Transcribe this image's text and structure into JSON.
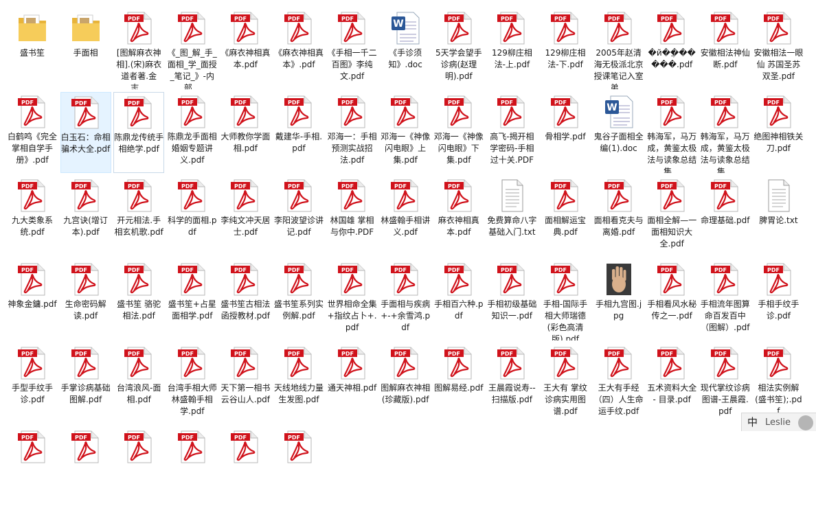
{
  "items": [
    {
      "label": "盛书笙",
      "icon": "folder-icon"
    },
    {
      "label": "手面相",
      "icon": "folder-icon"
    },
    {
      "label": "[图解麻衣神相].(宋)麻衣道者著.金志…",
      "icon": "pdf-icon"
    },
    {
      "label": "《_图_解_手_面相_学_面授_笔记_》-内部…",
      "icon": "pdf-icon"
    },
    {
      "label": "《麻衣神相真本.pdf",
      "icon": "pdf-icon"
    },
    {
      "label": "《麻衣神相真本》.pdf",
      "icon": "pdf-icon"
    },
    {
      "label": "《手相一千二百图》李纯文.pdf",
      "icon": "pdf-icon"
    },
    {
      "label": "《手诊须知》.doc",
      "icon": "word-icon"
    },
    {
      "label": "5天学会望手诊病(赵理明).pdf",
      "icon": "pdf-icon"
    },
    {
      "label": "129柳庄相法-上.pdf",
      "icon": "pdf-icon"
    },
    {
      "label": "129柳庄相法-下.pdf",
      "icon": "pdf-icon"
    },
    {
      "label": "2005年赵清海无极派北京授课笔记入室弟…",
      "icon": "pdf-icon"
    },
    {
      "label": "�й�ֲ������.pdf",
      "icon": "pdf-icon"
    },
    {
      "label": "安徽相法神仙断.pdf",
      "icon": "pdf-icon"
    },
    {
      "label": "安徽相法一眼仙 苏国圣苏双圣.pdf",
      "icon": "pdf-icon"
    },
    {
      "label": "白鹤鸣《完全掌相自学手册》.pdf",
      "icon": "pdf-icon"
    },
    {
      "label": "白玉石：命相骗术大全.pdf",
      "icon": "pdf-icon"
    },
    {
      "label": "陈鼎龙传统手相绝学.pdf",
      "icon": "pdf-icon"
    },
    {
      "label": "陈鼎龙手面相婚姻专题讲义.pdf",
      "icon": "pdf-icon"
    },
    {
      "label": "大师教你学面相.pdf",
      "icon": "pdf-icon"
    },
    {
      "label": "戴建华-手相.pdf",
      "icon": "pdf-icon"
    },
    {
      "label": "邓海一：手相预测实战招法.pdf",
      "icon": "pdf-icon"
    },
    {
      "label": "邓海一《神像闪电眼》上集.pdf",
      "icon": "pdf-icon"
    },
    {
      "label": "邓海一《神像闪电眼》下集.pdf",
      "icon": "pdf-icon"
    },
    {
      "label": "高飞-揭开相学密码-手相过十关.PDF",
      "icon": "pdf-icon"
    },
    {
      "label": "骨相学.pdf",
      "icon": "pdf-icon"
    },
    {
      "label": "鬼谷子面相全编(1).doc",
      "icon": "word-icon"
    },
    {
      "label": "韩海军，马万成，黄鉴太极法与读象总结集…",
      "icon": "pdf-icon"
    },
    {
      "label": "韩海军，马万成，黄鉴太极法与读象总结集…",
      "icon": "pdf-icon"
    },
    {
      "label": "绝图神相铁关刀.pdf",
      "icon": "pdf-icon"
    },
    {
      "label": "九大类象系统.pdf",
      "icon": "pdf-icon"
    },
    {
      "label": "九宫诀(增订本).pdf",
      "icon": "pdf-icon"
    },
    {
      "label": "开元相法.手相玄机歌.pdf",
      "icon": "pdf-icon"
    },
    {
      "label": "科学的面相.pdf",
      "icon": "pdf-icon"
    },
    {
      "label": "李纯文冲天居士.pdf",
      "icon": "pdf-icon"
    },
    {
      "label": "李阳波望诊讲记.pdf",
      "icon": "pdf-icon"
    },
    {
      "label": "林国雄 掌相与你中.PDF",
      "icon": "pdf-icon"
    },
    {
      "label": "林盛翰手相讲义.pdf",
      "icon": "pdf-icon"
    },
    {
      "label": "麻衣神相真本.pdf",
      "icon": "pdf-icon"
    },
    {
      "label": "免费算命八字基础入门.txt",
      "icon": "txt-icon"
    },
    {
      "label": "面相解运宝典.pdf",
      "icon": "pdf-icon"
    },
    {
      "label": "面相看克夫与离婚.pdf",
      "icon": "pdf-icon"
    },
    {
      "label": "面相全解—一面相知识大全.pdf",
      "icon": "pdf-icon"
    },
    {
      "label": "命理基础.pdf",
      "icon": "pdf-icon"
    },
    {
      "label": "脾胃论.txt",
      "icon": "txt-icon"
    },
    {
      "label": "神象金鏞.pdf",
      "icon": "pdf-icon"
    },
    {
      "label": "生命密码解读.pdf",
      "icon": "pdf-icon"
    },
    {
      "label": "盛书笙 骆驼相法.pdf",
      "icon": "pdf-icon"
    },
    {
      "label": "盛书笙+占星面相学.pdf",
      "icon": "pdf-icon"
    },
    {
      "label": "盛书笙古相法函授教材.pdf",
      "icon": "pdf-icon"
    },
    {
      "label": "盛书笙系列实例解.pdf",
      "icon": "pdf-icon"
    },
    {
      "label": "世界相命全集+指纹占卜+.pdf",
      "icon": "pdf-icon"
    },
    {
      "label": "手面相与疾病+-+余雪鸿.pdf",
      "icon": "pdf-icon"
    },
    {
      "label": "手相百六种.pdf",
      "icon": "pdf-icon"
    },
    {
      "label": "手相初级基础知识一.pdf",
      "icon": "pdf-icon"
    },
    {
      "label": "手相-国际手相大师瑞德(彩色高清版).pdf",
      "icon": "pdf-icon"
    },
    {
      "label": "手相九宫图.jpg",
      "icon": "hand-image-icon"
    },
    {
      "label": "手相看风水秘传之一.pdf",
      "icon": "pdf-icon"
    },
    {
      "label": "手相流年图算命百发百中（图解）.pdf",
      "icon": "pdf-icon"
    },
    {
      "label": "手相手纹手诊.pdf",
      "icon": "pdf-icon"
    },
    {
      "label": "手型手纹手诊.pdf",
      "icon": "pdf-icon"
    },
    {
      "label": "手掌诊病基础图解.pdf",
      "icon": "pdf-icon"
    },
    {
      "label": "台湾浪风-面相.pdf",
      "icon": "pdf-icon"
    },
    {
      "label": "台湾手相大师林盛翰手相学.pdf",
      "icon": "pdf-icon"
    },
    {
      "label": "天下第一相书 云谷山人.pdf",
      "icon": "pdf-icon"
    },
    {
      "label": "天线地线力量生发图.pdf",
      "icon": "pdf-icon"
    },
    {
      "label": "通天神相.pdf",
      "icon": "pdf-icon"
    },
    {
      "label": "图解麻衣神相(珍藏版).pdf",
      "icon": "pdf-icon"
    },
    {
      "label": "图解易经.pdf",
      "icon": "pdf-icon"
    },
    {
      "label": "王晨霞说寿--扫描版.pdf",
      "icon": "pdf-icon"
    },
    {
      "label": "王大有 掌纹诊病实用图谱.pdf",
      "icon": "pdf-icon"
    },
    {
      "label": "王大有手经（四）人生命运手纹.pdf",
      "icon": "pdf-icon"
    },
    {
      "label": "五术资料大全 - 目录.pdf",
      "icon": "pdf-icon"
    },
    {
      "label": "现代掌纹诊病图谱-王晨霞.pdf",
      "icon": "pdf-icon"
    },
    {
      "label": "相法实例解(盛书笙);.pdf",
      "icon": "pdf-icon"
    },
    {
      "label": "",
      "icon": "pdf-icon"
    },
    {
      "label": "",
      "icon": "pdf-icon"
    },
    {
      "label": "",
      "icon": "pdf-icon"
    },
    {
      "label": "",
      "icon": "pdf-icon"
    },
    {
      "label": "",
      "icon": "pdf-icon"
    },
    {
      "label": "",
      "icon": "pdf-icon"
    }
  ],
  "icon_text": {
    "pdf": "PDF",
    "word": "W"
  },
  "colors": {
    "pdf_red": "#d0121b",
    "selection": "#e5f3ff",
    "word_blue": "#2b5797",
    "folder": "#f0c04a"
  },
  "tray": {
    "ime_label": "中",
    "user_label": "Leslie"
  }
}
